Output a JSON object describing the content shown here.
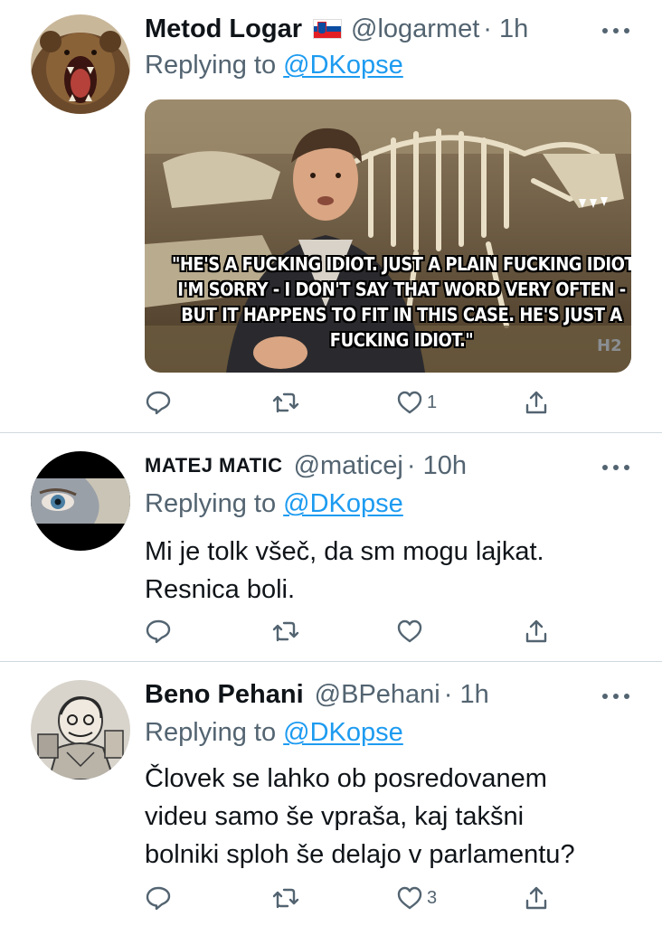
{
  "colors": {
    "accent": "#1d9bf0",
    "secondary_text": "#536471",
    "primary_text": "#0f1419",
    "divider": "#cfd9de"
  },
  "tweets": [
    {
      "name": "Metod Logar",
      "handle": "@logarmet",
      "time": "· 1h",
      "flag_icon": "slovenia-flag",
      "reply_prefix": "Replying to",
      "reply_to": "@DKopse",
      "media_caption": [
        "\"HE'S A FUCKING IDIOT. JUST A PLAIN FUCKING IDIOT.",
        "I'M SORRY - I DON'T SAY THAT WORD VERY OFTEN -",
        "BUT IT HAPPENS TO FIT IN THIS CASE. HE'S JUST A",
        "FUCKING IDIOT.\""
      ],
      "likes": "1",
      "avatar_icon": "bear-avatar"
    },
    {
      "name": "MATEJ MATIC",
      "handle": "@maticej",
      "time": "· 10h",
      "reply_prefix": "Replying to",
      "reply_to": "@DKopse",
      "text_lines": [
        "Mi je tolk všeč, da sm mogu lajkat.",
        "Resnica boli."
      ],
      "likes": "",
      "avatar_icon": "eye-avatar"
    },
    {
      "name": "Beno Pehani",
      "handle": "@BPehani",
      "time": "· 1h",
      "reply_prefix": "Replying to",
      "reply_to": "@DKopse",
      "text_lines": [
        "Človek se lahko ob posredovanem",
        "videu samo še vpraša, kaj takšni",
        "bolniki sploh še delajo v parlamentu?"
      ],
      "likes": "3",
      "avatar_icon": "caricature-avatar"
    }
  ],
  "action_icons": [
    "reply-icon",
    "retweet-icon",
    "like-icon",
    "share-icon"
  ]
}
